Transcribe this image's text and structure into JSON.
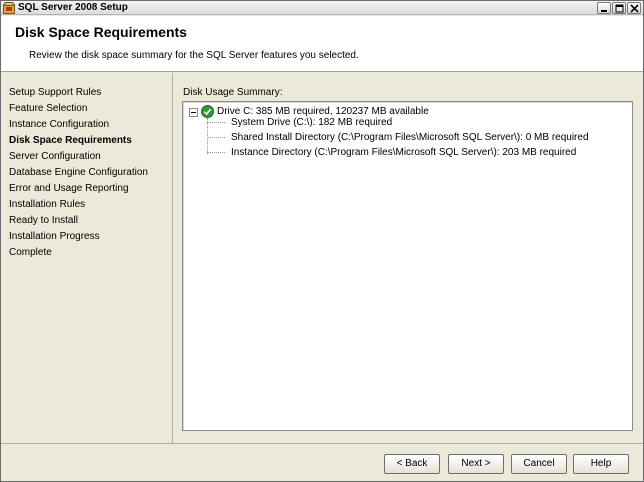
{
  "window": {
    "title": "SQL Server 2008 Setup"
  },
  "header": {
    "title": "Disk Space Requirements",
    "subtitle": "Review the disk space summary for the SQL Server features you selected."
  },
  "sidebar": {
    "items": [
      {
        "label": "Setup Support Rules",
        "active": false
      },
      {
        "label": "Feature Selection",
        "active": false
      },
      {
        "label": "Instance Configuration",
        "active": false
      },
      {
        "label": "Disk Space Requirements",
        "active": true
      },
      {
        "label": "Server Configuration",
        "active": false
      },
      {
        "label": "Database Engine Configuration",
        "active": false
      },
      {
        "label": "Error and Usage Reporting",
        "active": false
      },
      {
        "label": "Installation Rules",
        "active": false
      },
      {
        "label": "Ready to Install",
        "active": false
      },
      {
        "label": "Installation Progress",
        "active": false
      },
      {
        "label": "Complete",
        "active": false
      }
    ]
  },
  "main": {
    "section_label": "Disk Usage Summary:",
    "tree": {
      "root": "Drive C: 385 MB required, 120237 MB available",
      "children": [
        "System Drive (C:\\): 182 MB required",
        "Shared Install Directory (C:\\Program Files\\Microsoft SQL Server\\): 0 MB required",
        "Instance Directory (C:\\Program Files\\Microsoft SQL Server\\): 203 MB required"
      ]
    }
  },
  "footer": {
    "back_label": "< Back",
    "next_label": "Next >",
    "cancel_label": "Cancel",
    "help_label": "Help"
  },
  "icons": {
    "app": "sql-server-setup-icon",
    "status_ok": "green-check-icon",
    "status_ok_color": "#2e9b2e"
  }
}
